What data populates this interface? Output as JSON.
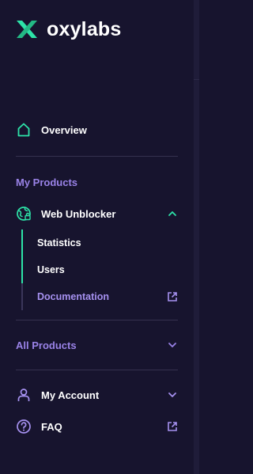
{
  "brand": {
    "name": "oxylabs"
  },
  "nav": {
    "overview": {
      "label": "Overview"
    },
    "my_products_title": "My Products",
    "web_unblocker": {
      "label": "Web Unblocker",
      "expanded": true,
      "sub_items": [
        {
          "label": "Statistics",
          "active": true
        },
        {
          "label": "Users",
          "active": true
        },
        {
          "label": "Documentation",
          "external": true
        }
      ]
    },
    "all_products_title": "All Products",
    "my_account": {
      "label": "My Account"
    },
    "faq": {
      "label": "FAQ"
    }
  },
  "colors": {
    "background": "#17142e",
    "accent_green": "#2de3a8",
    "accent_purple": "#9a83e8",
    "text": "#ffffff"
  },
  "icons": {
    "logo": "oxylabs-x-logo",
    "overview": "home-icon",
    "web_unblocker": "globe-unlock-icon",
    "my_account": "user-icon",
    "faq": "question-circle-icon",
    "external": "external-link-icon",
    "expand": "chevron-down-icon",
    "collapse": "chevron-up-icon"
  }
}
